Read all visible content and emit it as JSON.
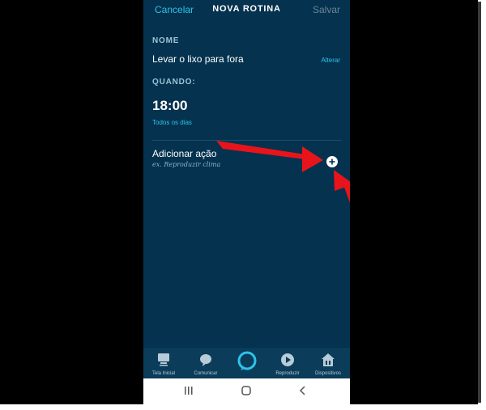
{
  "header": {
    "cancel_label": "Cancelar",
    "title": "NOVA ROTINA",
    "save_label": "Salvar"
  },
  "name_section": {
    "label": "NOME",
    "value": "Levar o lixo para fora",
    "edit_label": "Alterar"
  },
  "when_section": {
    "label": "QUANDO:",
    "time": "18:00",
    "repeat": "Todos os dias"
  },
  "action_section": {
    "title": "Adicionar ação",
    "hint": "ex. Reproduzir clima",
    "add_icon": "plus-circle-icon"
  },
  "bottom_nav": {
    "items": [
      {
        "label": "Tela Inicial",
        "icon": "home-screen-icon"
      },
      {
        "label": "Comunicar",
        "icon": "chat-bubble-icon"
      },
      {
        "label": "",
        "icon": "alexa-ring-icon"
      },
      {
        "label": "Reproduzir",
        "icon": "play-icon"
      },
      {
        "label": "Dispositivos",
        "icon": "devices-house-icon"
      }
    ]
  },
  "system_nav": [
    "recents-icon",
    "home-icon",
    "back-icon"
  ],
  "colors": {
    "background": "#04324f",
    "accent": "#2ec4e8",
    "annotation_arrow": "#e8141b"
  }
}
